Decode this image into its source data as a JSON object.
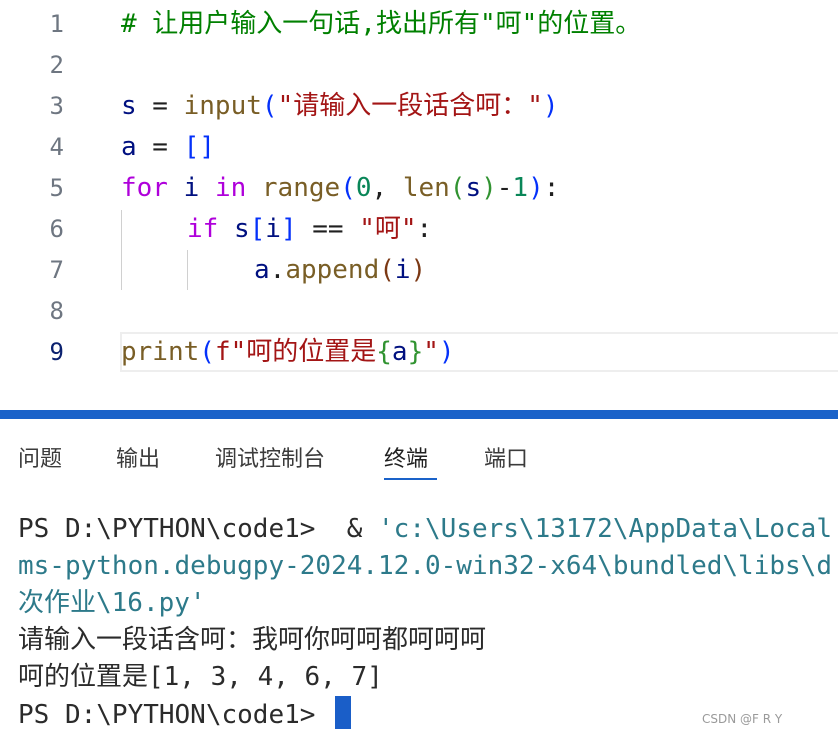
{
  "editor": {
    "line_numbers": [
      "1",
      "2",
      "3",
      "4",
      "5",
      "6",
      "7",
      "8",
      "9"
    ],
    "l1": {
      "comment": "# 让用户输入一句话,找出所有\"呵\"的位置。"
    },
    "l3": {
      "var": "s",
      "eq": " = ",
      "fn": "input",
      "open": "(",
      "str": "\"请输入一段话含呵：\"",
      "close": ")"
    },
    "l4": {
      "var": "a",
      "eq": " = ",
      "list": "[]"
    },
    "l5": {
      "kw1": "for",
      "sp1": " ",
      "var_i": "i",
      "sp2": " ",
      "kw2": "in",
      "sp3": " ",
      "fn1": "range",
      "open1": "(",
      "num1": "0",
      "comma": ", ",
      "fn2": "len",
      "open2": "(",
      "var_s": "s",
      "close2": ")",
      "minus": "-",
      "num2": "1",
      "close1": ")",
      "colon": ":"
    },
    "l6": {
      "kw": "if",
      "sp": " ",
      "var_s": "s",
      "lb": "[",
      "var_i": "i",
      "rb": "]",
      "eq": " == ",
      "str": "\"呵\"",
      "colon": ":"
    },
    "l7": {
      "var_a": "a",
      "dot": ".",
      "fn": "append",
      "open": "(",
      "var_i": "i",
      "close": ")"
    },
    "l9": {
      "fn": "print",
      "open": "(",
      "str1": "f\"呵的位置是",
      "lb": "{",
      "var": "a",
      "rb": "}",
      "str2": "\"",
      "close": ")"
    }
  },
  "panel": {
    "tabs": [
      "问题",
      "输出",
      "调试控制台",
      "终端",
      "端口"
    ],
    "active_tab": "终端"
  },
  "terminal": {
    "line1_prompt": "PS D:\\PYTHON\\code1>  & ",
    "line1_path": "'c:\\Users\\13172\\AppData\\Local",
    "line2": "ms-python.debugpy-2024.12.0-win32-x64\\bundled\\libs\\d",
    "line3": "次作业\\16.py'",
    "line4": "请输入一段话含呵：我呵你呵呵都呵呵呵",
    "line5": "呵的位置是[1, 3, 4, 6, 7]",
    "line6_prompt": "PS D:\\PYTHON\\code1> "
  },
  "watermark": "CSDN @F R Y",
  "colors": {
    "accent": "#1a62c9",
    "keyword": "#af00db",
    "function": "#795e26",
    "variable": "#001080",
    "string": "#a31515",
    "number": "#098658",
    "comment": "#008000"
  }
}
